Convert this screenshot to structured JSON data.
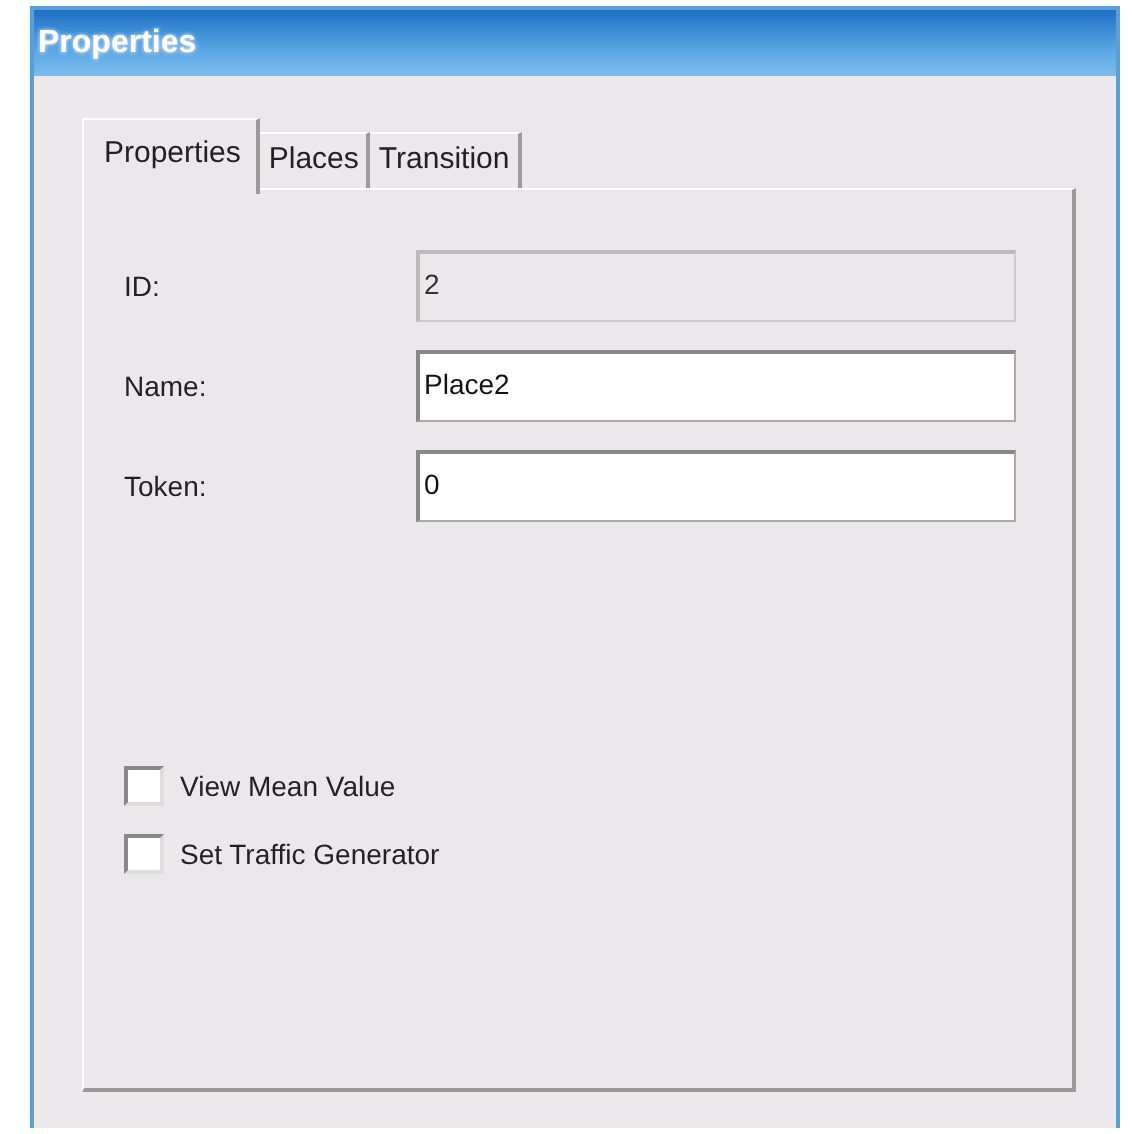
{
  "window": {
    "title": "Properties"
  },
  "tabs": [
    {
      "label": "Properties",
      "selected": true
    },
    {
      "label": "Places",
      "selected": false
    },
    {
      "label": "Transition",
      "selected": false
    }
  ],
  "fields": [
    {
      "label": "ID:",
      "value": "2",
      "disabled": true
    },
    {
      "label": "Name:",
      "value": "Place2",
      "disabled": false
    },
    {
      "label": "Token:",
      "value": "0",
      "disabled": false
    }
  ],
  "checkboxes": [
    {
      "label": "View Mean Value",
      "checked": false
    },
    {
      "label": "Set Traffic Generator",
      "checked": false
    }
  ]
}
